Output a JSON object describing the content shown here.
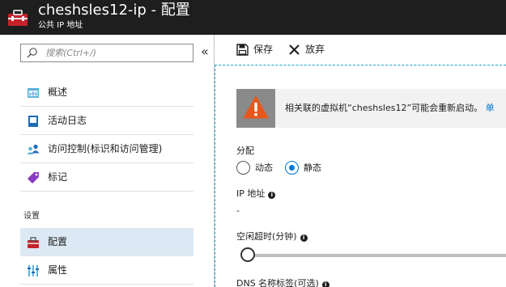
{
  "header": {
    "title": "cheshsles12-ip - 配置",
    "subtitle": "公共 IP 地址",
    "icon": "toolbox-icon",
    "icon_color": "#c4222b"
  },
  "sidebar": {
    "search_placeholder": "搜索(Ctrl+/)",
    "collapse_glyph": "«",
    "items": [
      {
        "label": "概述",
        "icon": "overview-icon"
      },
      {
        "label": "活动日志",
        "icon": "activity-log-icon"
      },
      {
        "label": "访问控制(标识和访问管理)",
        "icon": "access-control-icon"
      },
      {
        "label": "标记",
        "icon": "tag-icon"
      }
    ],
    "section_settings": "设置",
    "settings_items": [
      {
        "label": "配置",
        "icon": "configuration-icon",
        "active": true
      },
      {
        "label": "属性",
        "icon": "properties-icon"
      }
    ],
    "active_bg": "#dce9f5"
  },
  "toolbar": {
    "save_label": "保存",
    "discard_label": "放弃"
  },
  "warning": {
    "text": "相关联的虚拟机“cheshsles12”可能会重新启动。",
    "link": "单",
    "accent": "#e8571b"
  },
  "form": {
    "assignment_label": "分配",
    "options": [
      {
        "label": "动态",
        "checked": false
      },
      {
        "label": "静态",
        "checked": true
      }
    ],
    "ip_label": "IP 地址",
    "ip_value": "-",
    "idle_timeout_label": "空闲超时(分钟)",
    "idle_timeout_value": 0,
    "dns_label": "DNS 名称标签(可选)"
  },
  "colors": {
    "accent": "#0078d4",
    "header_bg": "#1e1e1e",
    "focus_dash": "#1ba3c6"
  }
}
